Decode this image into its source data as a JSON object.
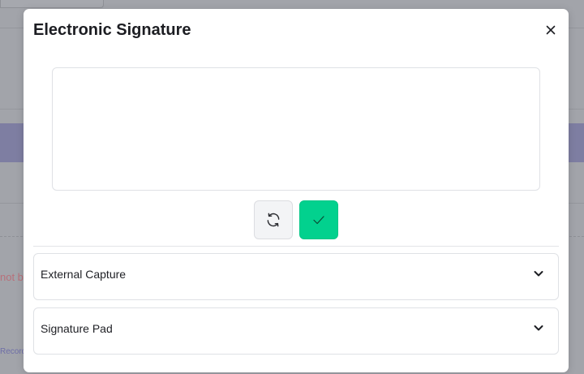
{
  "background": {
    "partial_text": "not b",
    "partial_link": "Record"
  },
  "modal": {
    "title": "Electronic Signature",
    "close_icon": "close-icon",
    "canvas": "signature-canvas",
    "actions": {
      "reset_icon": "refresh-icon",
      "confirm_icon": "check-icon",
      "confirm_color": "#02d18e"
    },
    "sections": [
      {
        "label": "External Capture",
        "icon": "chevron-down-icon",
        "expanded": false
      },
      {
        "label": "Signature Pad",
        "icon": "chevron-down-icon",
        "expanded": false
      }
    ]
  }
}
